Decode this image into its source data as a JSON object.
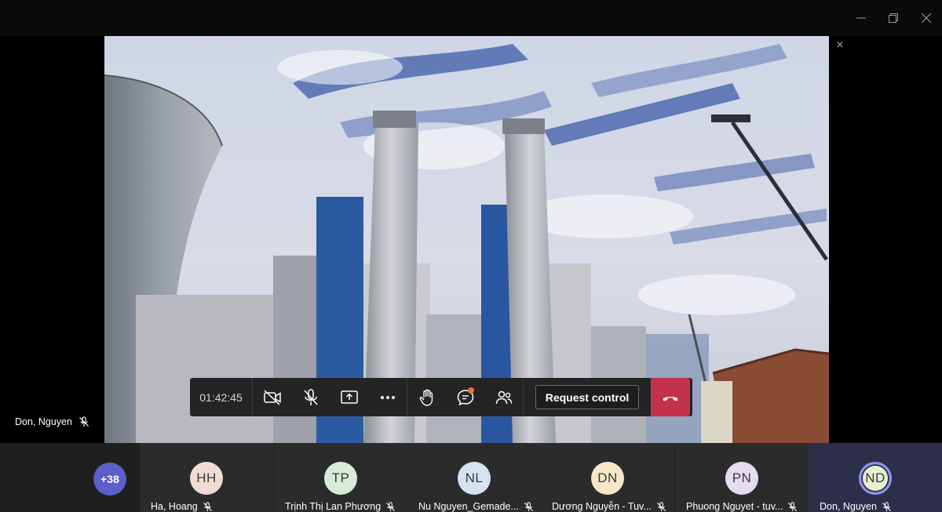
{
  "window": {
    "controls": [
      {
        "name": "minimize",
        "icon": "minimize-icon"
      },
      {
        "name": "maximize",
        "icon": "restore-icon"
      },
      {
        "name": "close",
        "icon": "close-icon"
      }
    ]
  },
  "stage": {
    "close_glyph": "×",
    "presenter_name": "Don, Nguyen",
    "presenter_icon": "mic-off-icon"
  },
  "controls": {
    "timer": "01:42:45",
    "camera_icon": "camera-off-icon",
    "mic_icon": "mic-off-icon",
    "share_icon": "share-screen-icon",
    "more_icon": "more-actions-icon",
    "hand_icon": "raise-hand-icon",
    "chat_icon": "chat-icon",
    "people_icon": "participants-icon",
    "request_control_label": "Request control",
    "hangup_icon": "hang-up-icon",
    "hangup_color": "#c4314b"
  },
  "participants": {
    "overflow_count": "+38",
    "list": [
      {
        "initials": "HH",
        "name": "Ha, Hoang",
        "color": "#f1dcd5"
      },
      {
        "initials": "TP",
        "name": "Trịnh Thị Lan Phương",
        "color": "#d7ecd8"
      },
      {
        "initials": "NL",
        "name": "Nu Nguyen_Gemade...",
        "color": "#d5e2f2"
      },
      {
        "initials": "DN",
        "name": "Dương Nguyễn - Tuv...",
        "color": "#f6e7c9"
      },
      {
        "initials": "PN",
        "name": "Phuong Nguyet - tuv...",
        "color": "#e5dcf2"
      },
      {
        "initials": "ND",
        "name": "Don, Nguyen",
        "color": "#e6f0d0"
      }
    ]
  }
}
